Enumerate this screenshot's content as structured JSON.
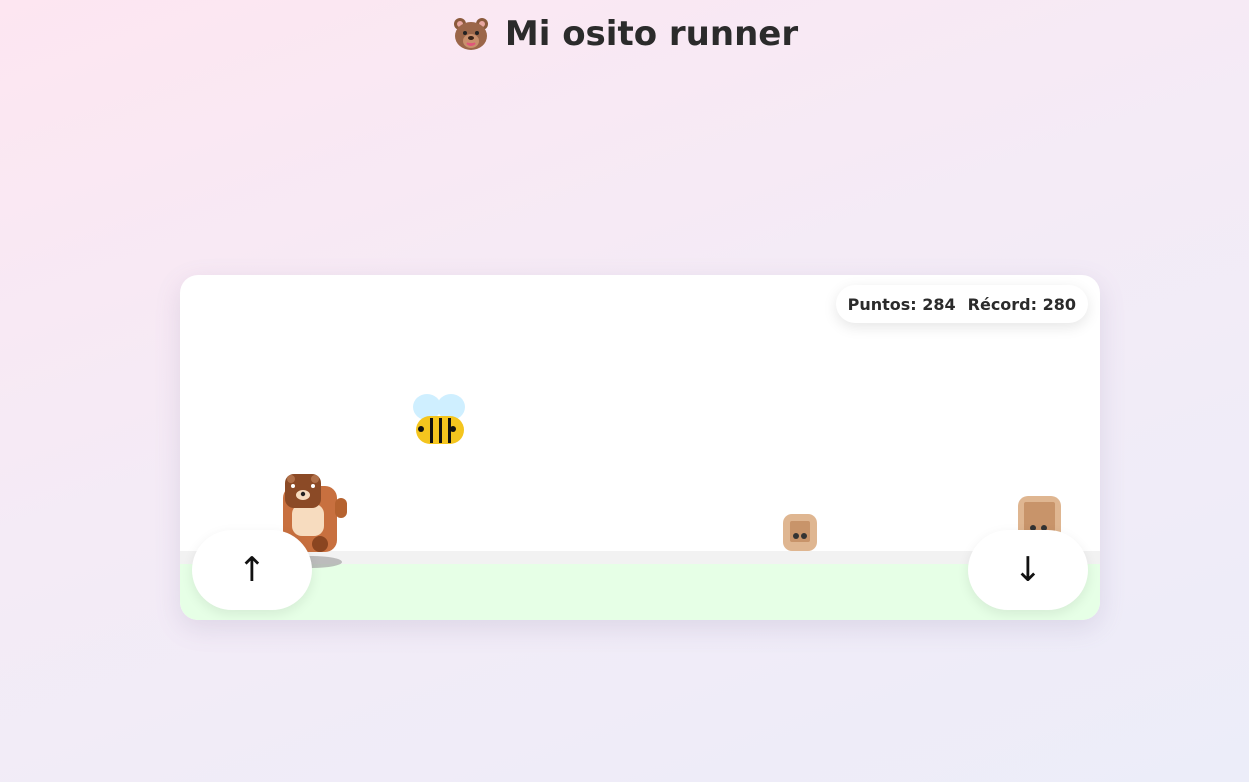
{
  "header": {
    "title": "Mi osito runner",
    "icon": "bear-face-icon"
  },
  "score": {
    "points": "Puntos: 284",
    "record": "Récord: 280"
  },
  "controls": {
    "jump": "↑",
    "duck": "↓"
  },
  "colors": {
    "bear": "#c8703f",
    "bear_belly": "#f7dcbf",
    "ground": "#e6ffe6",
    "obstacle": "#dfb691",
    "bee_body": "#f4c51e",
    "bee_wings": "#cfefff"
  }
}
